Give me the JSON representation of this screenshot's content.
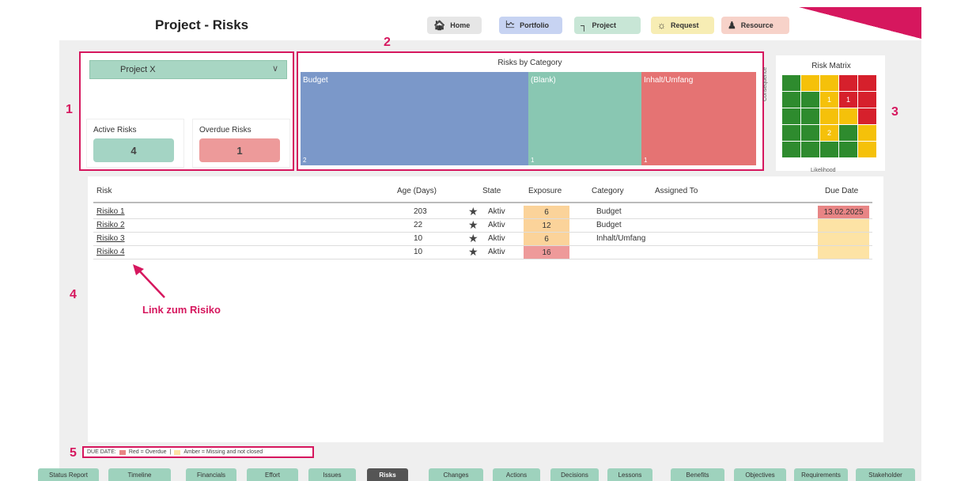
{
  "page_title": "Project - Risks",
  "nav": [
    {
      "label": "Home",
      "icon": "home-icon",
      "color": "#e6e6e6"
    },
    {
      "label": "Portfolio",
      "icon": "portfolio-icon",
      "color": "#c7d3f2"
    },
    {
      "label": "Project",
      "icon": "project-icon",
      "color": "#c8e6d6"
    },
    {
      "label": "Request",
      "icon": "request-icon",
      "color": "#f7edb4"
    },
    {
      "label": "Resource",
      "icon": "resource-icon",
      "color": "#f7d2c9"
    }
  ],
  "annotations": {
    "a1": "1",
    "a2": "2",
    "a3": "3",
    "a4": "4",
    "a5": "5",
    "link_note": "Link zum Risiko"
  },
  "filter": {
    "selected": "Project X"
  },
  "kpis": {
    "active_label": "Active Risks",
    "active_value": "4",
    "active_color": "#a4d4c4",
    "overdue_label": "Overdue Risks",
    "overdue_value": "1",
    "overdue_color": "#ed9a9a"
  },
  "treemap": {
    "title": "Risks by Category",
    "tiles": [
      {
        "label": "Budget",
        "count": "2",
        "value": 2,
        "color": "#7b98c9"
      },
      {
        "label": "(Blank)",
        "count": "1",
        "value": 1,
        "color": "#89c7b2"
      },
      {
        "label": "Inhalt/Umfang",
        "count": "1",
        "value": 1,
        "color": "#e57373"
      }
    ]
  },
  "matrix": {
    "title": "Risk Matrix",
    "y_label": "Consequence",
    "x_label": "Likelihood",
    "colors": {
      "G": "#2e8b2e",
      "Y": "#f5c10a",
      "R": "#d6202c"
    },
    "rows": [
      [
        "G",
        "Y",
        "Y",
        "R",
        "R"
      ],
      [
        "G",
        "G",
        "Y",
        "R",
        "R"
      ],
      [
        "G",
        "G",
        "Y",
        "Y",
        "R"
      ],
      [
        "G",
        "G",
        "Y",
        "G",
        "Y"
      ],
      [
        "G",
        "G",
        "G",
        "G",
        "Y"
      ]
    ],
    "labels": [
      {
        "row": 1,
        "col": 2,
        "text": "1"
      },
      {
        "row": 1,
        "col": 3,
        "text": "1"
      },
      {
        "row": 3,
        "col": 2,
        "text": "2"
      }
    ]
  },
  "table": {
    "headers": {
      "risk": "Risk",
      "age": "Age (Days)",
      "state": "State",
      "exposure": "Exposure",
      "category": "Category",
      "assigned": "Assigned To",
      "due": "Due Date"
    },
    "rows": [
      {
        "risk": "Risiko 1",
        "age": "203",
        "state": "Aktiv",
        "exposure": "6",
        "exp_color": "#fbd39a",
        "category": "Budget",
        "assigned": "",
        "due": "13.02.2025",
        "due_color": "#e88585"
      },
      {
        "risk": "Risiko 2",
        "age": "22",
        "state": "Aktiv",
        "exposure": "12",
        "exp_color": "#fbd39a",
        "category": "Budget",
        "assigned": "",
        "due": "",
        "due_color": "#fde3a5"
      },
      {
        "risk": "Risiko 3",
        "age": "10",
        "state": "Aktiv",
        "exposure": "6",
        "exp_color": "#fbd39a",
        "category": "Inhalt/Umfang",
        "assigned": "",
        "due": "",
        "due_color": "#fde3a5"
      },
      {
        "risk": "Risiko 4",
        "age": "10",
        "state": "Aktiv",
        "exposure": "16",
        "exp_color": "#ee9a9a",
        "category": "",
        "assigned": "",
        "due": "",
        "due_color": "#fde3a5"
      }
    ]
  },
  "legend": {
    "prefix": "DUE DATE:",
    "red_text": "Red = Overdue",
    "sep": "|",
    "amber_text": "Amber = Missing and not closed",
    "red_color": "#e88585",
    "amber_color": "#fde3a5"
  },
  "tabs": [
    "Status Report",
    "Timeline",
    "Financials",
    "Effort",
    "Issues",
    "Risks",
    "Changes",
    "Actions",
    "Decisions",
    "Lessons",
    "Benefits",
    "Objectives",
    "Requirements",
    "Stakeholder"
  ],
  "active_tab": "Risks"
}
